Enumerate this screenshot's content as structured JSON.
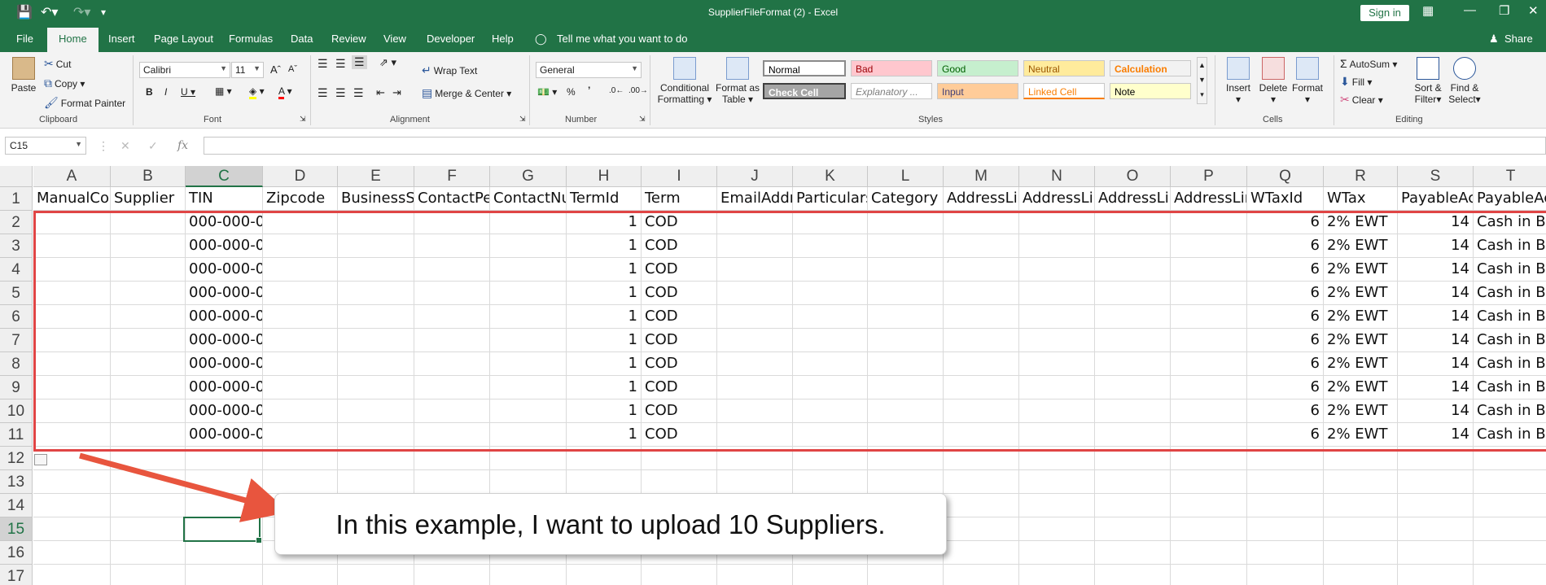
{
  "app": {
    "window_title": "SupplierFileFormat (2)  -  Excel",
    "sign_in": "Sign in",
    "share": "Share",
    "tell_me": "Tell me what you want to do"
  },
  "tabs": [
    "File",
    "Home",
    "Insert",
    "Page Layout",
    "Formulas",
    "Data",
    "Review",
    "View",
    "Developer",
    "Help"
  ],
  "ribbon": {
    "clipboard": {
      "label": "Clipboard",
      "paste": "Paste",
      "cut": "Cut",
      "copy": "Copy",
      "format_painter": "Format Painter"
    },
    "font": {
      "label": "Font",
      "name": "Calibri",
      "size": "11"
    },
    "alignment": {
      "label": "Alignment",
      "wrap_text": "Wrap Text",
      "merge_center": "Merge & Center"
    },
    "number": {
      "label": "Number",
      "format": "General"
    },
    "styles": {
      "label": "Styles",
      "conditional_formatting": [
        "Conditional",
        "Formatting"
      ],
      "format_as_table": [
        "Format as",
        "Table"
      ],
      "cells": [
        {
          "name": "Normal",
          "bg": "#ffffff",
          "fg": "#000000"
        },
        {
          "name": "Bad",
          "bg": "#ffc7ce",
          "fg": "#9c0006"
        },
        {
          "name": "Good",
          "bg": "#c6efce",
          "fg": "#006100"
        },
        {
          "name": "Neutral",
          "bg": "#ffeb9c",
          "fg": "#9c5700"
        },
        {
          "name": "Calculation",
          "bg": "#f2f2f2",
          "fg": "#fa7d00"
        },
        {
          "name": "Check Cell",
          "bg": "#a5a5a5",
          "fg": "#ffffff"
        },
        {
          "name": "Explanatory ...",
          "bg": "#ffffff",
          "fg": "#7f7f7f"
        },
        {
          "name": "Input",
          "bg": "#ffcc99",
          "fg": "#3f3f76"
        },
        {
          "name": "Linked Cell",
          "bg": "#ffffff",
          "fg": "#fa7d00"
        },
        {
          "name": "Note",
          "bg": "#ffffcc",
          "fg": "#000000"
        }
      ]
    },
    "cells": {
      "label": "Cells",
      "insert": "Insert",
      "delete": "Delete",
      "format": "Format"
    },
    "editing": {
      "label": "Editing",
      "autosum": "AutoSum",
      "fill": "Fill",
      "clear": "Clear",
      "sort_filter": [
        "Sort &",
        "Filter"
      ],
      "find_select": [
        "Find &",
        "Select"
      ]
    }
  },
  "formula_bar": {
    "name_box": "C15",
    "fx": "fx",
    "formula": ""
  },
  "grid": {
    "columns": [
      "A",
      "B",
      "C",
      "D",
      "E",
      "F",
      "G",
      "H",
      "I",
      "J",
      "K",
      "L",
      "M",
      "N",
      "O",
      "P",
      "Q",
      "R",
      "S",
      "T"
    ],
    "rows": [
      "1",
      "2",
      "3",
      "4",
      "5",
      "6",
      "7",
      "8",
      "9",
      "10",
      "11",
      "12",
      "13",
      "14",
      "15",
      "16",
      "17"
    ],
    "headers": [
      "ManualCo",
      "Supplier",
      "TIN",
      "Zipcode",
      "BusinessSt",
      "ContactPe",
      "ContactNu",
      "TermId",
      "Term",
      "EmailAddr",
      "Particulars",
      "Category",
      "AddressLir",
      "AddressLir",
      "AddressLir",
      "AddressLir",
      "WTaxId",
      "WTax",
      "PayableAc",
      "PayableAc"
    ],
    "data_rows": [
      {
        "tin": "000-000-0",
        "term_id": "1",
        "term": "COD",
        "wtax_id": "6",
        "wtax": "2% EWT",
        "payable_ac": "14",
        "payable_ac_name": "Cash in Ba"
      },
      {
        "tin": "000-000-0",
        "term_id": "1",
        "term": "COD",
        "wtax_id": "6",
        "wtax": "2% EWT",
        "payable_ac": "14",
        "payable_ac_name": "Cash in Ba"
      },
      {
        "tin": "000-000-0",
        "term_id": "1",
        "term": "COD",
        "wtax_id": "6",
        "wtax": "2% EWT",
        "payable_ac": "14",
        "payable_ac_name": "Cash in Ba"
      },
      {
        "tin": "000-000-0",
        "term_id": "1",
        "term": "COD",
        "wtax_id": "6",
        "wtax": "2% EWT",
        "payable_ac": "14",
        "payable_ac_name": "Cash in Ba"
      },
      {
        "tin": "000-000-0",
        "term_id": "1",
        "term": "COD",
        "wtax_id": "6",
        "wtax": "2% EWT",
        "payable_ac": "14",
        "payable_ac_name": "Cash in Ba"
      },
      {
        "tin": "000-000-0",
        "term_id": "1",
        "term": "COD",
        "wtax_id": "6",
        "wtax": "2% EWT",
        "payable_ac": "14",
        "payable_ac_name": "Cash in Ba"
      },
      {
        "tin": "000-000-0",
        "term_id": "1",
        "term": "COD",
        "wtax_id": "6",
        "wtax": "2% EWT",
        "payable_ac": "14",
        "payable_ac_name": "Cash in Ba"
      },
      {
        "tin": "000-000-0",
        "term_id": "1",
        "term": "COD",
        "wtax_id": "6",
        "wtax": "2% EWT",
        "payable_ac": "14",
        "payable_ac_name": "Cash in Ba"
      },
      {
        "tin": "000-000-0",
        "term_id": "1",
        "term": "COD",
        "wtax_id": "6",
        "wtax": "2% EWT",
        "payable_ac": "14",
        "payable_ac_name": "Cash in Ba"
      },
      {
        "tin": "000-000-0",
        "term_id": "1",
        "term": "COD",
        "wtax_id": "6",
        "wtax": "2% EWT",
        "payable_ac": "14",
        "payable_ac_name": "Cash in Ba"
      }
    ],
    "selected_cell": "C15"
  },
  "annotation": {
    "callout_text": "In this example, I want to upload 10 Suppliers.",
    "highlight_color": "#e04545"
  },
  "colors": {
    "excel_green": "#217346"
  }
}
